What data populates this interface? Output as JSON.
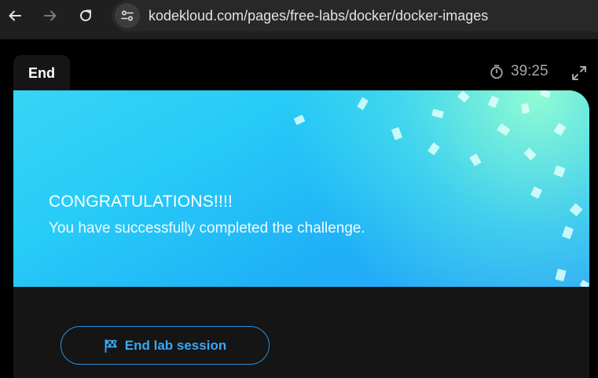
{
  "browser": {
    "url": "kodekloud.com/pages/free-labs/docker/docker-images"
  },
  "lab": {
    "tab_label": "End",
    "timer": "39:25"
  },
  "banner": {
    "title": "CONGRATULATIONS!!!!",
    "message": "You have successfully completed the challenge."
  },
  "actions": {
    "end_session_label": "End lab session"
  },
  "colors": {
    "accent": "#3aa8f5",
    "banner_start": "#37d4f5",
    "banner_end": "#2aa0f8"
  },
  "icons": [
    "back-arrow-icon",
    "forward-arrow-icon",
    "reload-icon",
    "site-settings-icon",
    "stopwatch-icon",
    "expand-icon",
    "checkered-flag-icon"
  ]
}
